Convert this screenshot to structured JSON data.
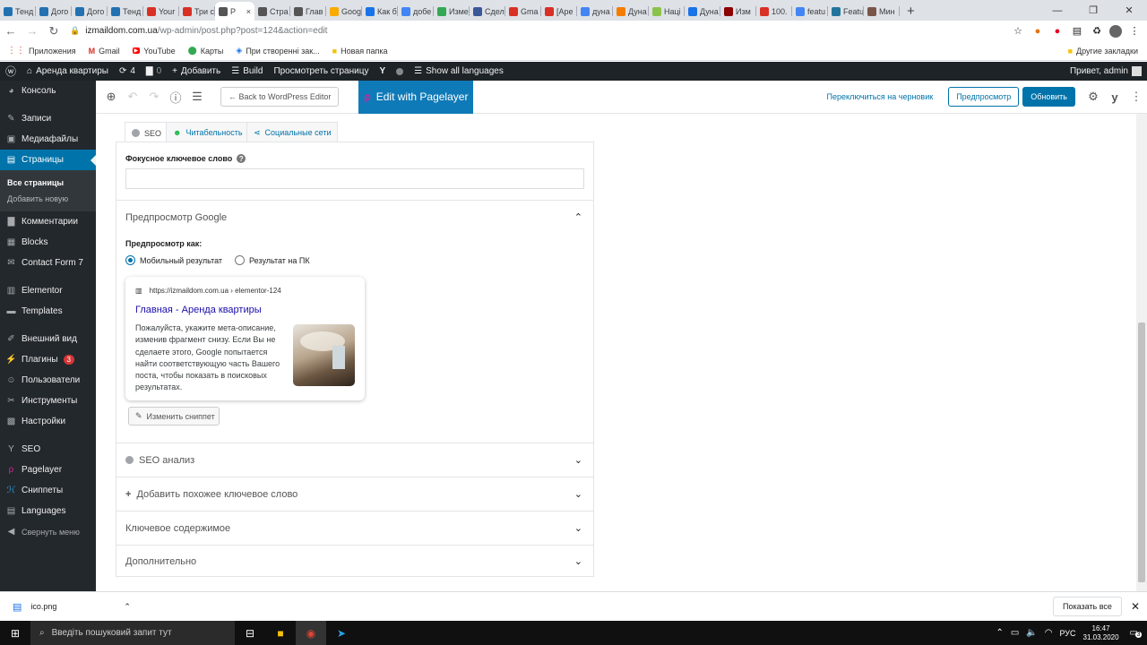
{
  "browser": {
    "tabs": [
      {
        "label": "Тенд",
        "color": "#2271b1"
      },
      {
        "label": "Дого",
        "color": "#2271b1"
      },
      {
        "label": "Дого",
        "color": "#2271b1"
      },
      {
        "label": "Тенд",
        "color": "#2271b1"
      },
      {
        "label": "Your",
        "color": "#d93025"
      },
      {
        "label": "Три с",
        "color": "#d93025"
      },
      {
        "label": "Р",
        "color": "#555555",
        "active": true
      },
      {
        "label": "Стра",
        "color": "#555555"
      },
      {
        "label": "Глав",
        "color": "#555555"
      },
      {
        "label": "Goog",
        "color": "#f9ab00"
      },
      {
        "label": "Как б",
        "color": "#1a73e8"
      },
      {
        "label": "добе",
        "color": "#4285f4"
      },
      {
        "label": "Изме",
        "color": "#34a853"
      },
      {
        "label": "Сдел",
        "color": "#3b5998"
      },
      {
        "label": "Gma",
        "color": "#d93025"
      },
      {
        "label": "[Аре",
        "color": "#d93025"
      },
      {
        "label": "дуна",
        "color": "#4285f4"
      },
      {
        "label": "Дуна",
        "color": "#f57c00"
      },
      {
        "label": "Наці",
        "color": "#8bc34a"
      },
      {
        "label": "Дуна",
        "color": "#1a73e8"
      },
      {
        "label": "Изм",
        "color": "#8b0000"
      },
      {
        "label": "100.",
        "color": "#d93025"
      },
      {
        "label": "featu",
        "color": "#4285f4"
      },
      {
        "label": "Featu",
        "color": "#21759b"
      },
      {
        "label": "Мин",
        "color": "#795548"
      }
    ],
    "new_tab": "+",
    "window_controls": [
      "—",
      "❐",
      "✕"
    ],
    "url_domain": "izmaildom.com.ua",
    "url_path": "/wp-admin/post.php?post=124&action=edit",
    "bookmarks": [
      {
        "label": "Приложения",
        "icon": "apps-grid-icon"
      },
      {
        "label": "Gmail",
        "icon": "gmail-icon"
      },
      {
        "label": "YouTube",
        "icon": "youtube-icon"
      },
      {
        "label": "Карты",
        "icon": "maps-icon"
      },
      {
        "label": "При створенні зак...",
        "icon": "link-icon"
      },
      {
        "label": "Новая папка",
        "icon": "folder-icon"
      }
    ],
    "other_bookmarks": "Другие закладки"
  },
  "adminbar": {
    "site": "Аренда квартиры",
    "updates": "4",
    "comments": "0",
    "add": "Добавить",
    "build": "Build",
    "view": "Просмотреть страницу",
    "languages": "Show all languages",
    "greeting": "Привет, admin"
  },
  "sidebar": {
    "items": [
      {
        "label": "Консоль",
        "icon": "dashboard-icon"
      },
      {
        "label": "Записи",
        "icon": "pin-icon"
      },
      {
        "label": "Медиафайлы",
        "icon": "media-icon"
      },
      {
        "label": "Страницы",
        "icon": "pages-icon",
        "active": true
      },
      {
        "label": "Комментарии",
        "icon": "comments-icon"
      },
      {
        "label": "Blocks",
        "icon": "blocks-icon"
      },
      {
        "label": "Contact Form 7",
        "icon": "mail-icon"
      },
      {
        "label": "Elementor",
        "icon": "elementor-icon"
      },
      {
        "label": "Templates",
        "icon": "folder-icon"
      },
      {
        "label": "Внешний вид",
        "icon": "brush-icon"
      },
      {
        "label": "Плагины",
        "icon": "plugin-icon",
        "badge": "3"
      },
      {
        "label": "Пользователи",
        "icon": "users-icon"
      },
      {
        "label": "Инструменты",
        "icon": "tools-icon"
      },
      {
        "label": "Настройки",
        "icon": "settings-icon"
      },
      {
        "label": "SEO",
        "icon": "yoast-icon"
      },
      {
        "label": "Pagelayer",
        "icon": "pagelayer-icon"
      },
      {
        "label": "Сниппеты",
        "icon": "snippets-icon"
      },
      {
        "label": "Languages",
        "icon": "languages-icon"
      }
    ],
    "submenu": [
      "Все страницы",
      "Добавить новую"
    ],
    "collapse": "Свернуть меню"
  },
  "editor": {
    "back_button": "← Back to WordPress Editor",
    "pagelayer_button": "Edit with Pagelayer",
    "switch_draft": "Переключиться на черновик",
    "preview": "Предпросмотр",
    "update": "Обновить"
  },
  "yoast": {
    "tabs": [
      "SEO",
      "Читабельность",
      "Социальные сети"
    ],
    "focus_label": "Фокусное ключевое слово",
    "focus_value": "",
    "google_preview": "Предпросмотр Google",
    "preview_as": "Предпросмотр как:",
    "radio_mobile": "Мобильный результат",
    "radio_desktop": "Результат на ПК",
    "mobile_selected": true,
    "snippet": {
      "url": "https://izmaildom.com.ua › elementor-124",
      "title": "Главная - Аренда квартиры",
      "description": "Пожалуйста, укажите мета-описание, изменив фрагмент снизу. Если Вы не сделаете этого, Google попытается найти соответствующую часть Вашего поста, чтобы показать в поисковых результатах."
    },
    "edit_snippet": "Изменить сниппет",
    "sections": [
      "SEO анализ",
      "Добавить похожее ключевое слово",
      "Ключевое содержимое",
      "Дополнительно"
    ]
  },
  "download": {
    "file": "ico.png",
    "show_all": "Показать все"
  },
  "taskbar": {
    "search_placeholder": "Введіть пошуковий запит тут",
    "lang": "РУС",
    "time": "16:47",
    "date": "31.03.2020",
    "notif": "3"
  }
}
